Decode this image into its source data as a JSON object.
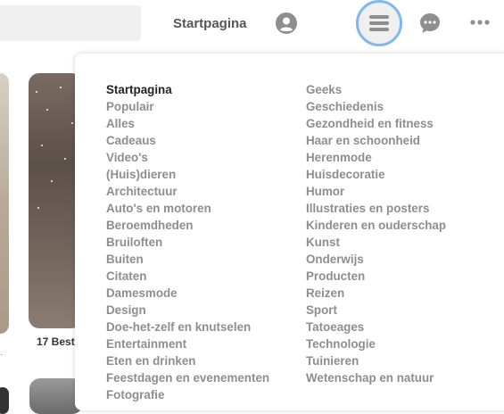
{
  "header": {
    "home_label": "Startpagina"
  },
  "icons": {
    "profile": "user-circle",
    "menu": "hamburger",
    "messages": "chat-bubble",
    "more": "ellipsis"
  },
  "colors": {
    "menu_focus_ring": "#7fb8f0",
    "active_text": "#222222",
    "inactive_text": "#8e8e8e"
  },
  "feed": {
    "pin_caption": "17 Best",
    "pin_dot": "·"
  },
  "menu": {
    "active_item": "Startpagina",
    "left_column": [
      "Startpagina",
      "Populair",
      "Alles",
      "Cadeaus",
      "Video's",
      "(Huis)dieren",
      "Architectuur",
      "Auto's en motoren",
      "Beroemdheden",
      "Bruiloften",
      "Buiten",
      "Citaten",
      "Damesmode",
      "Design",
      "Doe-het-zelf en knutselen",
      "Entertainment",
      "Eten en drinken",
      "Feestdagen en evenementen",
      "Fotografie"
    ],
    "right_column": [
      "Geeks",
      "Geschiedenis",
      "Gezondheid en fitness",
      "Haar en schoonheid",
      "Herenmode",
      "Huisdecoratie",
      "Humor",
      "Illustraties en posters",
      "Kinderen en ouderschap",
      "Kunst",
      "Onderwijs",
      "Producten",
      "Reizen",
      "Sport",
      "Tatoeages",
      "Technologie",
      "Tuinieren",
      "Wetenschap en natuur"
    ]
  }
}
